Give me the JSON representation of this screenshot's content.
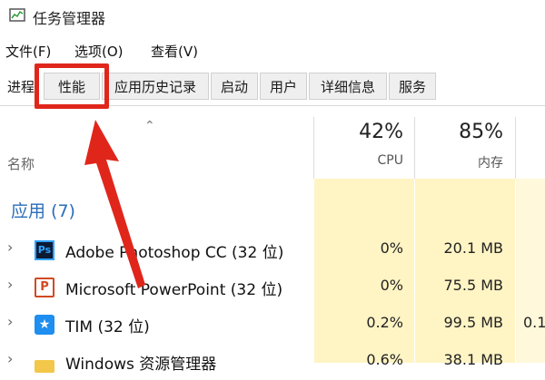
{
  "window": {
    "title": "任务管理器"
  },
  "menu": [
    "文件(F)",
    "选项(O)",
    "查看(V)"
  ],
  "tabs": [
    "进程",
    "性能",
    "应用历史记录",
    "启动",
    "用户",
    "详细信息",
    "服务"
  ],
  "columns": {
    "name_label": "名称",
    "cpu": {
      "percent": "42%",
      "label": "CPU"
    },
    "memory": {
      "percent": "85%",
      "label": "内存"
    }
  },
  "group": {
    "title": "应用 (7)"
  },
  "processes": [
    {
      "name": "Adobe Photoshop CC (32 位)",
      "icon": "photoshop-icon",
      "cpu": "0%",
      "memory": "20.1 MB",
      "extra": ""
    },
    {
      "name": "Microsoft PowerPoint (32 位)",
      "icon": "powerpoint-icon",
      "cpu": "0%",
      "memory": "75.5 MB",
      "extra": ""
    },
    {
      "name": "TIM (32 位)",
      "icon": "tim-icon",
      "cpu": "0.2%",
      "memory": "99.5 MB",
      "extra": "0.1"
    },
    {
      "name": "Windows 资源管理器",
      "icon": "folder-icon",
      "cpu": "0.6%",
      "memory": "38.1 MB",
      "extra": ""
    }
  ],
  "colors": {
    "highlight": "#e0261b",
    "accent": "#2a6ebb",
    "heat": "#fff4c4"
  }
}
